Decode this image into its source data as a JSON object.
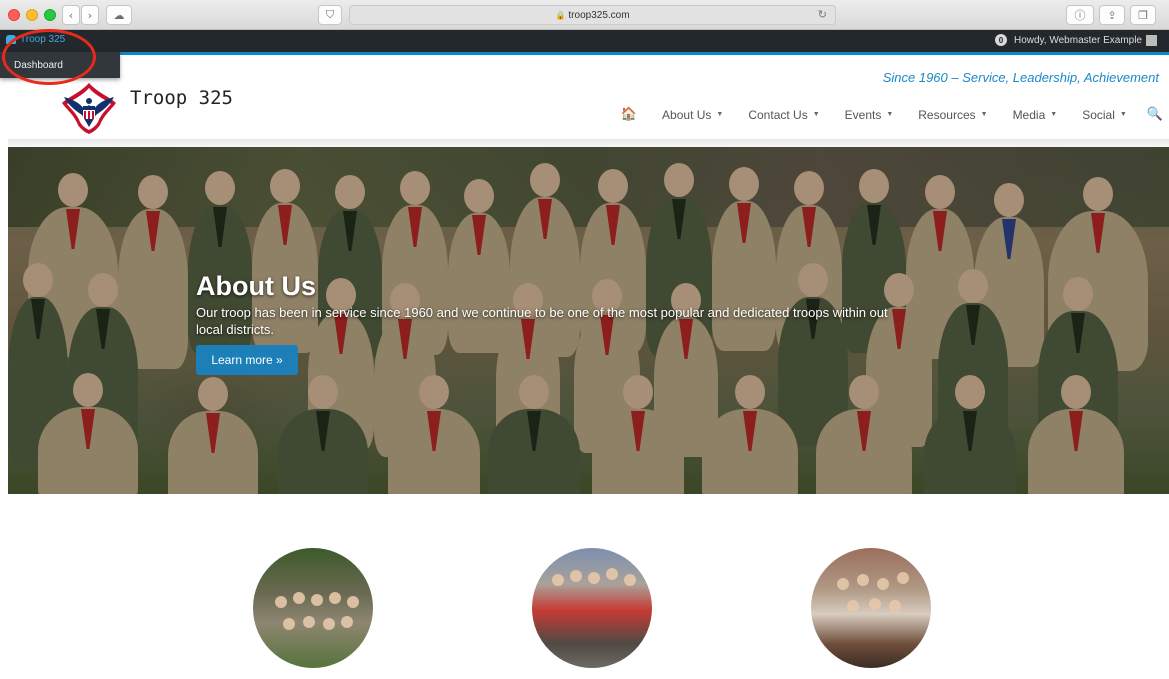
{
  "browser": {
    "url": "troop325.com"
  },
  "adminbar": {
    "site_name": "Troop 325",
    "howdy": "Howdy, Webmaster Example",
    "badge": "0",
    "dropdown_item": "Dashboard"
  },
  "header": {
    "brand": "Troop 325",
    "tagline": "Since 1960 – Service, Leadership, Achievement"
  },
  "nav": {
    "items": [
      {
        "label": "About Us"
      },
      {
        "label": "Contact Us"
      },
      {
        "label": "Events"
      },
      {
        "label": "Resources"
      },
      {
        "label": "Media"
      },
      {
        "label": "Social"
      }
    ]
  },
  "hero": {
    "title": "About Us",
    "text": "Our troop has been in service since 1960 and we continue to be one of the most popular and dedicated troops within out local districts.",
    "button": "Learn more »"
  },
  "colors": {
    "accent": "#1a89c8",
    "admin_bar": "#23282d",
    "highlight_ring": "#e8291c"
  },
  "icons": {
    "home": "home-icon",
    "search": "search-icon",
    "dashboard": "dashboard-icon"
  }
}
